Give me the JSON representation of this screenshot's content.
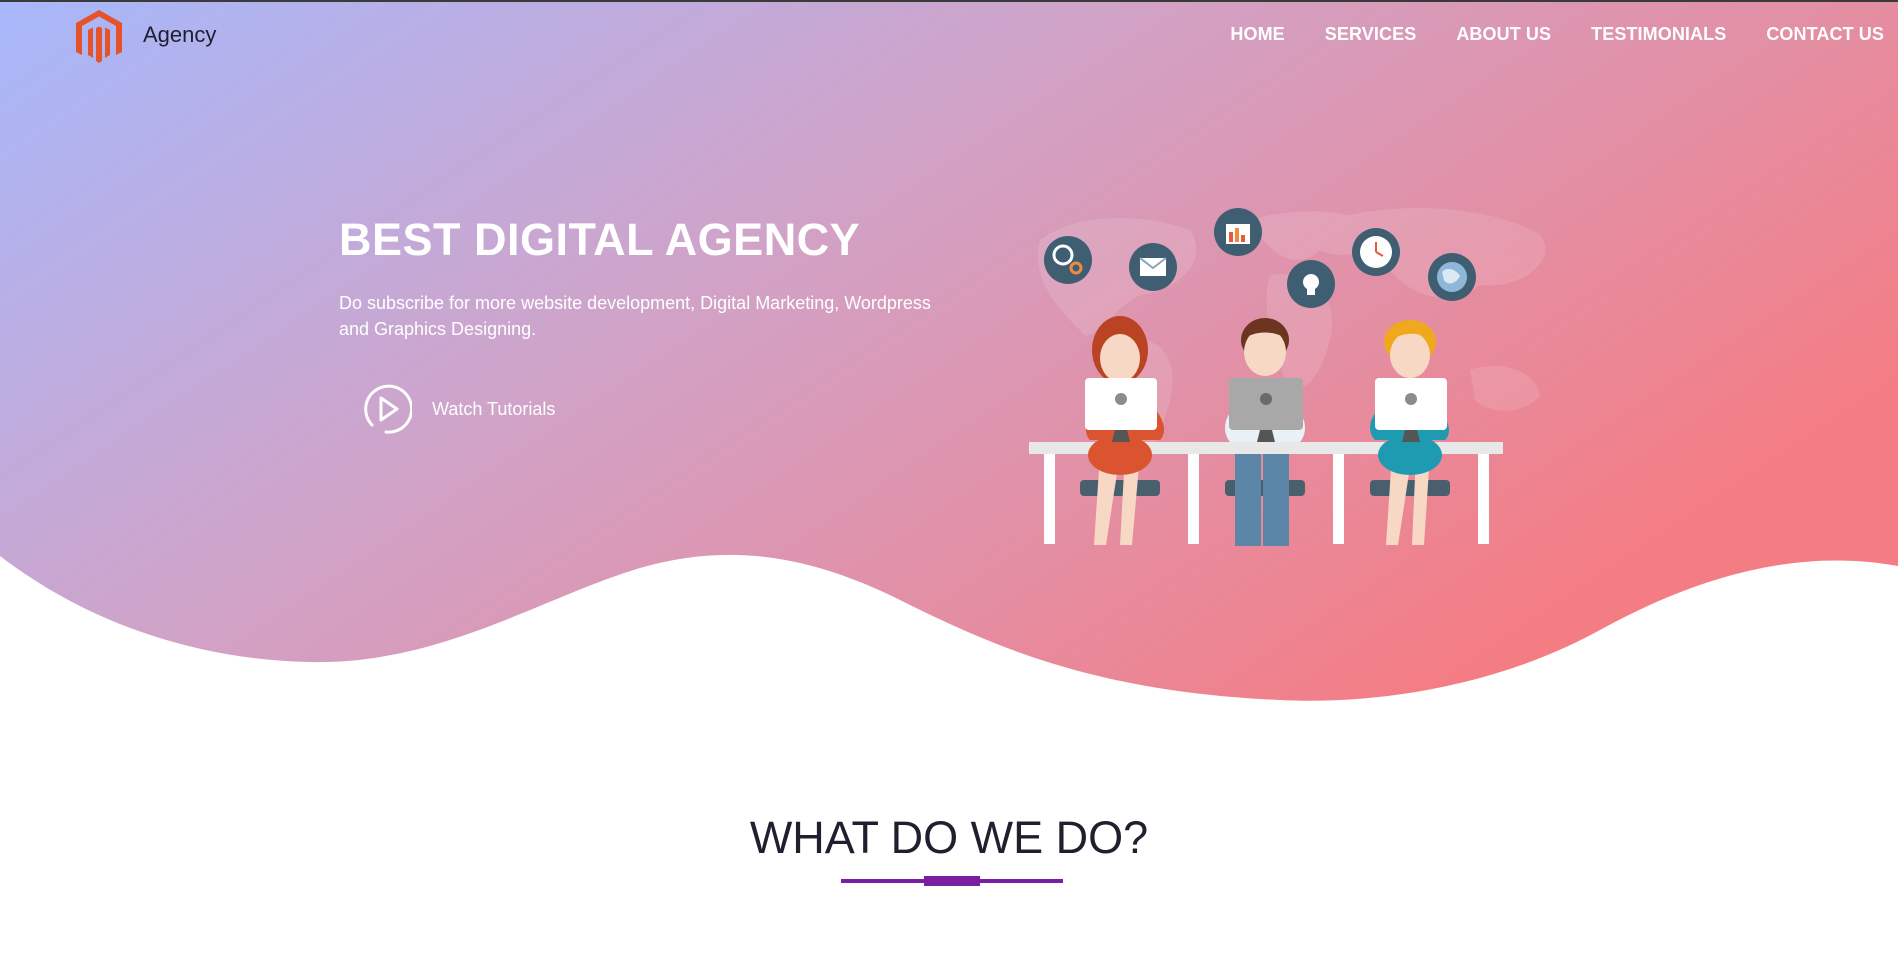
{
  "brand": {
    "name": "Agency",
    "logo_icon": "magento-logo-icon",
    "logo_color": "#e4532a"
  },
  "nav": {
    "items": [
      {
        "label": "HOME"
      },
      {
        "label": "SERVICES"
      },
      {
        "label": "ABOUT US"
      },
      {
        "label": "TESTIMONIALS"
      },
      {
        "label": "CONTACT US"
      }
    ]
  },
  "hero": {
    "title": "BEST DIGITAL AGENCY",
    "subtitle": "Do subscribe for more website development, Digital Marketing, Wordpress and Graphics Designing.",
    "cta_label": "Watch Tutorials",
    "cta_icon": "play-circle-icon",
    "gradient_start": "#a7b8fb",
    "gradient_mid": "#d3a1c4",
    "gradient_end": "#f47d84",
    "illustration": "three-people-at-computers-illustration"
  },
  "section": {
    "title": "WHAT DO WE DO?",
    "accent": "#7b1fa2"
  }
}
